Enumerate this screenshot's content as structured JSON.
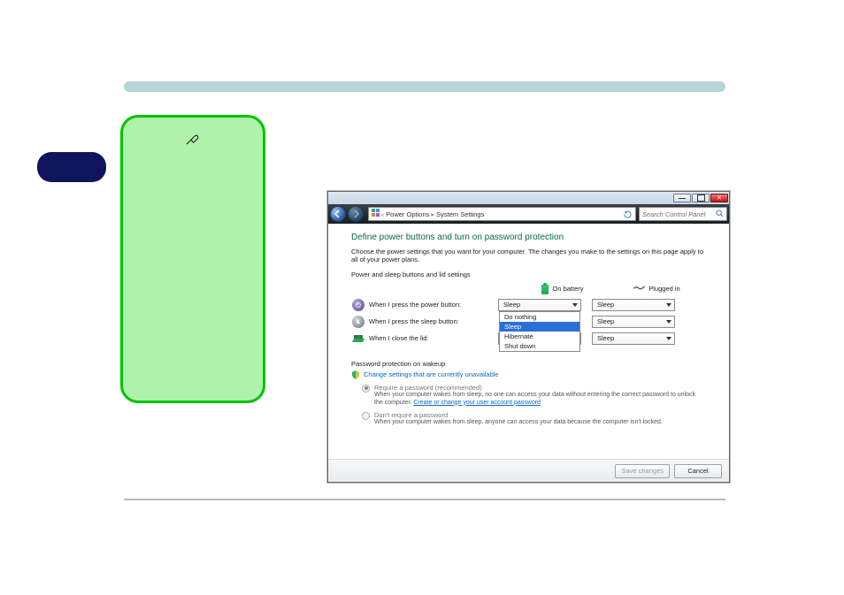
{
  "breadcrumb": {
    "root_icon": "control-panel-icon",
    "crumb1": "Power Options",
    "crumb2": "System Settings"
  },
  "search": {
    "placeholder": "Search Control Panel"
  },
  "page": {
    "title": "Define power buttons and turn on password protection",
    "desc": "Choose the power settings that you want for your computer. The changes you make to the settings on this page apply to all of your power plans.",
    "section": "Power and sleep buttons and lid settings",
    "col_battery": "On battery",
    "col_plugged": "Plugged in"
  },
  "rows": {
    "power": {
      "label": "When I press the power button:",
      "batt_value": "Sleep",
      "plug_value": "Sleep"
    },
    "sleep": {
      "label": "When I press the sleep button:",
      "batt_value": "",
      "plug_value": "Sleep"
    },
    "lid": {
      "label": "When I close the lid:",
      "batt_value": "Sleep",
      "plug_value": "Sleep"
    }
  },
  "dropdown_options": {
    "o0": "Do nothing",
    "o1": "Sleep",
    "o2": "Hibernate",
    "o3": "Shut down"
  },
  "password": {
    "section": "Password protection on wakeup",
    "change_link": "Change settings that are currently unavailable",
    "r1_head": "Require a password (recommended)",
    "r1_body_a": "When your computer wakes from sleep, no one can access your data without entering the correct password to unlock the computer. ",
    "r1_link": "Create or change your user account password",
    "r2_head": "Don't require a password",
    "r2_body": "When your computer wakes from sleep, anyone can access your data because the computer isn't locked."
  },
  "footer": {
    "save": "Save changes",
    "cancel": "Cancel"
  }
}
